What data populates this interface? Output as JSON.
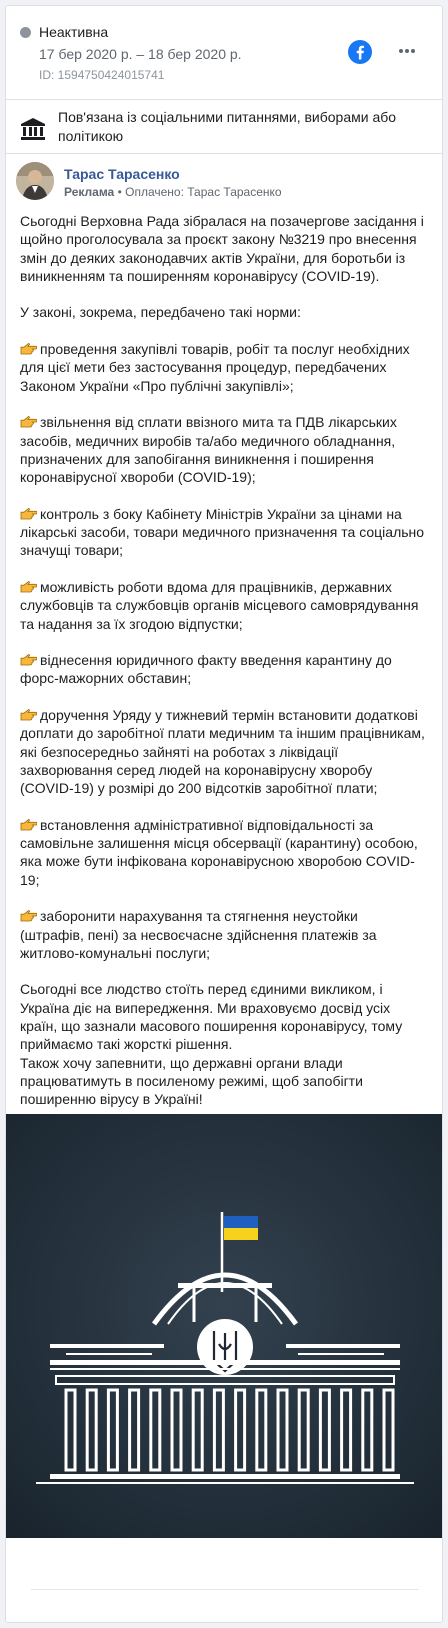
{
  "status": {
    "label": "Неактивна"
  },
  "ad": {
    "dates": "17 бер 2020 р. – 18 бер 2020 р.",
    "id": "ID: 1594750424015741"
  },
  "category": {
    "line1": "Пов'язана із соціальними питаннями, виборами або",
    "line2": "політикою"
  },
  "author": {
    "name": "Тарас Тарасенко",
    "sponsored_prefix": "Реклама",
    "paid_by": "Оплачено: Тарас Тарасенко"
  },
  "post": {
    "intro": [
      "Сьогодні Верховна Рада зібралася на позачергове засідання і",
      "щойно проголосувала за проєкт закону №3219 про внесення",
      "змін до деяких законодавчих актів України, для боротьби із",
      "виникненням та поширенням коронавірусу (COVID-19)."
    ],
    "lead": "У законі, зокрема, передбачено такі норми:",
    "items": [
      [
        "проведення закупівлі товарів, робіт та послуг необхідних",
        "для цієї мети без застосування процедур, передбачених",
        "Законом України «Про публічні закупівлі»;"
      ],
      [
        "звільнення від сплати ввізного мита та ПДВ лікарських",
        "засобів, медичних виробів та/або медичного обладнання,",
        "призначених для запобігання виникнення і поширення",
        "коронавірусної хвороби (COVID-19);"
      ],
      [
        "контроль з боку Кабінету Міністрів України за цінами на",
        "лікарські засоби, товари медичного призначення та соціально",
        "значущі товари;"
      ],
      [
        "можливість роботи вдома для працівників, державних",
        "службовців та службовців органів місцевого самоврядування",
        "та надання за їх згодою відпустки;"
      ],
      [
        "віднесення юридичного факту введення карантину до",
        "форс-мажорних обставин;"
      ],
      [
        "доручення Уряду у тижневий термін встановити додаткові",
        "доплати до заробітної плати медичним та іншим працівникам,",
        "які безпосередньо зайняті на роботах з ліквідації",
        "захворювання серед людей на коронавірусну хворобу",
        "(COVID-19) у розмірі до 200 відсотків заробітної плати;"
      ],
      [
        "встановлення адміністративної відповідальності за",
        "самовільне залишення місця обсервації (карантину) особою,",
        "яка може бути інфікована коронавірусною хворобою COVID-",
        "19;"
      ],
      [
        "заборонити нарахування та стягнення неустойки",
        "(штрафів, пені) за несвоєчасне здійснення платежів за",
        "житлово-комунальні послуги;"
      ]
    ],
    "closing": [
      "Сьогодні все людство стоїть перед єдиними викликом, і",
      "Україна діє на випередження. Ми враховуємо досвід усіх",
      "країн, що зазнали масового поширення коронавірусу, тому",
      "приймаємо такі жорсткі рішення.",
      "Також хочу запевнити, що державні органи влади",
      "працюватимуть в посиленому режимі, щоб запобігти",
      "поширенню вірусу в Україні!"
    ]
  },
  "icons": {
    "status": "status-dot-icon",
    "facebook": "facebook-icon",
    "more": "more-options-icon",
    "category": "government-building-icon",
    "bullet": "pointing-hand-icon"
  },
  "colors": {
    "status_dot": "#8d949e",
    "facebook_blue": "#1877f2",
    "author_link": "#385898",
    "image_bg_top": "#33414f",
    "image_bg_bottom": "#18232c",
    "flag_blue": "#1f5fbf",
    "flag_yellow": "#f7d21c"
  }
}
